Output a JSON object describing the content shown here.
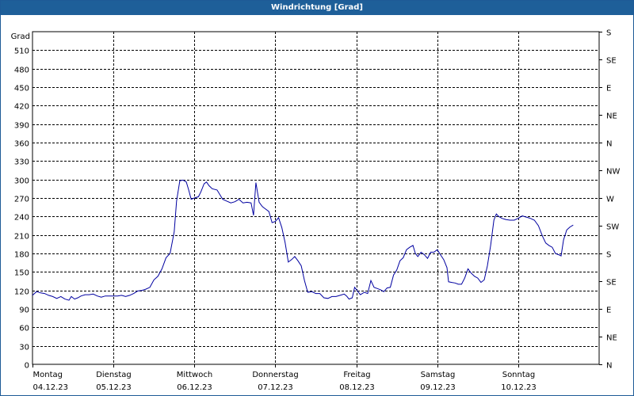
{
  "window": {
    "title": "Windrichtung [Grad]"
  },
  "chart_data": {
    "type": "line",
    "title": "Windrichtung [Grad]",
    "ylabel": "Grad",
    "ylim": [
      0,
      540
    ],
    "yticks": [
      0,
      30,
      60,
      90,
      120,
      150,
      180,
      210,
      240,
      270,
      300,
      330,
      360,
      390,
      420,
      450,
      480,
      510
    ],
    "right_ticks": [
      {
        "value": 0,
        "label": "N"
      },
      {
        "value": 45,
        "label": "NE"
      },
      {
        "value": 90,
        "label": "E"
      },
      {
        "value": 135,
        "label": "SE"
      },
      {
        "value": 180,
        "label": "S"
      },
      {
        "value": 225,
        "label": "SW"
      },
      {
        "value": 270,
        "label": "W"
      },
      {
        "value": 315,
        "label": "NW"
      },
      {
        "value": 360,
        "label": "N"
      },
      {
        "value": 405,
        "label": "NE"
      },
      {
        "value": 450,
        "label": "E"
      },
      {
        "value": 495,
        "label": "SE"
      },
      {
        "value": 540,
        "label": "S"
      }
    ],
    "xlim": [
      0,
      7
    ],
    "days": [
      {
        "day": "Montag",
        "date": "04.12.23"
      },
      {
        "day": "Dienstag",
        "date": "05.12.23"
      },
      {
        "day": "Mittwoch",
        "date": "06.12.23"
      },
      {
        "day": "Donnerstag",
        "date": "07.12.23"
      },
      {
        "day": "Freitag",
        "date": "08.12.23"
      },
      {
        "day": "Samstag",
        "date": "09.12.23"
      },
      {
        "day": "Sonntag",
        "date": "10.12.23"
      }
    ],
    "grid": true,
    "series": [
      {
        "color": "#0000a0",
        "points": [
          [
            0.0,
            112
          ],
          [
            0.05,
            118
          ],
          [
            0.1,
            116
          ],
          [
            0.15,
            115
          ],
          [
            0.2,
            112
          ],
          [
            0.25,
            110
          ],
          [
            0.3,
            107
          ],
          [
            0.35,
            110
          ],
          [
            0.4,
            106
          ],
          [
            0.45,
            104
          ],
          [
            0.48,
            110
          ],
          [
            0.52,
            106
          ],
          [
            0.56,
            108
          ],
          [
            0.6,
            111
          ],
          [
            0.65,
            113
          ],
          [
            0.7,
            113
          ],
          [
            0.75,
            114
          ],
          [
            0.8,
            111
          ],
          [
            0.85,
            109
          ],
          [
            0.9,
            111
          ],
          [
            0.95,
            111
          ],
          [
            1.0,
            111
          ],
          [
            1.05,
            111
          ],
          [
            1.1,
            112
          ],
          [
            1.15,
            110
          ],
          [
            1.2,
            112
          ],
          [
            1.25,
            115
          ],
          [
            1.3,
            119
          ],
          [
            1.35,
            120
          ],
          [
            1.4,
            122
          ],
          [
            1.45,
            125
          ],
          [
            1.5,
            137
          ],
          [
            1.55,
            143
          ],
          [
            1.6,
            155
          ],
          [
            1.65,
            173
          ],
          [
            1.7,
            180
          ],
          [
            1.75,
            215
          ],
          [
            1.78,
            265
          ],
          [
            1.82,
            298
          ],
          [
            1.86,
            299
          ],
          [
            1.9,
            296
          ],
          [
            1.93,
            283
          ],
          [
            1.96,
            268
          ],
          [
            2.0,
            270
          ],
          [
            2.05,
            272
          ],
          [
            2.08,
            280
          ],
          [
            2.12,
            293
          ],
          [
            2.15,
            296
          ],
          [
            2.18,
            290
          ],
          [
            2.22,
            285
          ],
          [
            2.28,
            283
          ],
          [
            2.35,
            268
          ],
          [
            2.4,
            265
          ],
          [
            2.45,
            262
          ],
          [
            2.5,
            264
          ],
          [
            2.55,
            268
          ],
          [
            2.6,
            262
          ],
          [
            2.65,
            263
          ],
          [
            2.7,
            262
          ],
          [
            2.73,
            242
          ],
          [
            2.76,
            295
          ],
          [
            2.8,
            263
          ],
          [
            2.84,
            256
          ],
          [
            2.88,
            252
          ],
          [
            2.92,
            248
          ],
          [
            2.96,
            230
          ],
          [
            3.0,
            232
          ],
          [
            3.04,
            238
          ],
          [
            3.08,
            222
          ],
          [
            3.12,
            198
          ],
          [
            3.16,
            166
          ],
          [
            3.2,
            170
          ],
          [
            3.24,
            175
          ],
          [
            3.28,
            168
          ],
          [
            3.32,
            160
          ],
          [
            3.36,
            136
          ],
          [
            3.4,
            117
          ],
          [
            3.45,
            118
          ],
          [
            3.5,
            115
          ],
          [
            3.55,
            115
          ],
          [
            3.6,
            108
          ],
          [
            3.65,
            107
          ],
          [
            3.7,
            110
          ],
          [
            3.75,
            110
          ],
          [
            3.8,
            112
          ],
          [
            3.85,
            114
          ],
          [
            3.88,
            111
          ],
          [
            3.91,
            106
          ],
          [
            3.95,
            108
          ],
          [
            3.98,
            125
          ],
          [
            4.02,
            118
          ],
          [
            4.05,
            113
          ],
          [
            4.1,
            117
          ],
          [
            4.14,
            115
          ],
          [
            4.18,
            136
          ],
          [
            4.22,
            125
          ],
          [
            4.26,
            123
          ],
          [
            4.3,
            121
          ],
          [
            4.34,
            118
          ],
          [
            4.38,
            124
          ],
          [
            4.42,
            125
          ],
          [
            4.46,
            145
          ],
          [
            4.5,
            153
          ],
          [
            4.54,
            168
          ],
          [
            4.58,
            173
          ],
          [
            4.62,
            186
          ],
          [
            4.66,
            190
          ],
          [
            4.7,
            193
          ],
          [
            4.73,
            180
          ],
          [
            4.76,
            175
          ],
          [
            4.8,
            182
          ],
          [
            4.84,
            178
          ],
          [
            4.88,
            172
          ],
          [
            4.92,
            182
          ],
          [
            4.96,
            182
          ],
          [
            5.0,
            186
          ],
          [
            5.04,
            178
          ],
          [
            5.08,
            170
          ],
          [
            5.12,
            157
          ],
          [
            5.14,
            134
          ],
          [
            5.18,
            133
          ],
          [
            5.22,
            132
          ],
          [
            5.26,
            130
          ],
          [
            5.3,
            130
          ],
          [
            5.34,
            140
          ],
          [
            5.38,
            155
          ],
          [
            5.42,
            148
          ],
          [
            5.46,
            143
          ],
          [
            5.5,
            140
          ],
          [
            5.54,
            133
          ],
          [
            5.58,
            137
          ],
          [
            5.62,
            160
          ],
          [
            5.66,
            193
          ],
          [
            5.7,
            234
          ],
          [
            5.73,
            244
          ],
          [
            5.76,
            240
          ],
          [
            5.8,
            237
          ],
          [
            5.85,
            235
          ],
          [
            5.9,
            234
          ],
          [
            5.95,
            234
          ],
          [
            6.0,
            237
          ],
          [
            6.05,
            241
          ],
          [
            6.1,
            239
          ],
          [
            6.15,
            237
          ],
          [
            6.2,
            234
          ],
          [
            6.25,
            225
          ],
          [
            6.3,
            208
          ],
          [
            6.34,
            197
          ],
          [
            6.38,
            193
          ],
          [
            6.42,
            190
          ],
          [
            6.46,
            180
          ],
          [
            6.5,
            178
          ],
          [
            6.53,
            176
          ],
          [
            6.56,
            202
          ],
          [
            6.6,
            218
          ],
          [
            6.64,
            223
          ],
          [
            6.68,
            226
          ]
        ]
      }
    ]
  }
}
